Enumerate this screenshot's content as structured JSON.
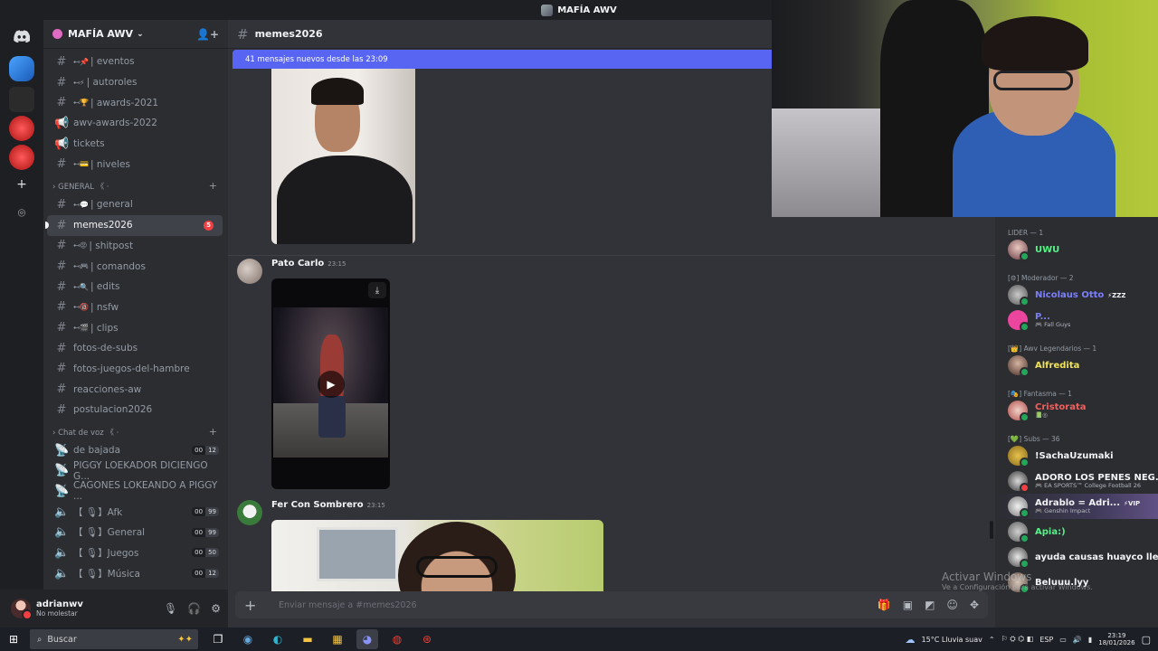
{
  "window": {
    "title": "MAFÍA AWV"
  },
  "server": {
    "name": "MAFÍA AWV"
  },
  "channels_top": [
    {
      "emoji": "⊷📌",
      "name": "| eventos",
      "type": "text"
    },
    {
      "emoji": "⊷⚡",
      "name": "| autoroles",
      "type": "text"
    },
    {
      "emoji": "⊷🏆",
      "name": "| awards-2021",
      "type": "text"
    },
    {
      "emoji": "",
      "name": "awv-awards-2022",
      "type": "announce"
    },
    {
      "emoji": "",
      "name": "tickets",
      "type": "announce"
    },
    {
      "emoji": "⊷💳",
      "name": "| niveles",
      "type": "text"
    }
  ],
  "category_general": {
    "label": "GENERAL 《 ·",
    "plus": "+"
  },
  "channels_general": [
    {
      "emoji": "⊷💬",
      "name": "| general",
      "type": "text",
      "active": false
    },
    {
      "emoji": "",
      "name": "memes2026",
      "type": "text",
      "active": true,
      "badge": "5"
    },
    {
      "emoji": "⊷😡",
      "name": "| shitpost",
      "type": "text"
    },
    {
      "emoji": "⊷🎮",
      "name": "| comandos",
      "type": "text"
    },
    {
      "emoji": "⊷🔍",
      "name": "| edits",
      "type": "text"
    },
    {
      "emoji": "⊷🔞",
      "name": "| nsfw",
      "type": "text"
    },
    {
      "emoji": "⊷🎬",
      "name": "| clips",
      "type": "text"
    },
    {
      "emoji": "",
      "name": "fotos-de-subs",
      "type": "text"
    },
    {
      "emoji": "",
      "name": "fotos-juegos-del-hambre",
      "type": "text"
    },
    {
      "emoji": "",
      "name": "reacciones-aw",
      "type": "text"
    },
    {
      "emoji": "",
      "name": "postulacion2026",
      "type": "text"
    }
  ],
  "category_voice": {
    "label": "Chat de voz 《 ·",
    "plus": "+"
  },
  "channels_voice": [
    {
      "name": "de bajada",
      "icon": "stage",
      "users": "00",
      "limit": "12"
    },
    {
      "name": "PIGGY LOEKADOR DICIENGO G...",
      "icon": "stage"
    },
    {
      "name": "CAGONES LOKEANDO A PIGGY ...",
      "icon": "stage"
    },
    {
      "name": "【 🎙】Afk",
      "icon": "voice",
      "users": "00",
      "limit": "99"
    },
    {
      "name": "【 🎙】General",
      "icon": "voice",
      "users": "00",
      "limit": "99"
    },
    {
      "name": "【 🎙】Juegos",
      "icon": "voice",
      "users": "00",
      "limit": "50"
    },
    {
      "name": "【 🎙】Música",
      "icon": "voice",
      "users": "00",
      "limit": "12"
    }
  ],
  "user": {
    "name": "adrianwv",
    "status": "No molestar"
  },
  "channel_header": {
    "name": "memes2026"
  },
  "new_messages_bar": "41 mensajes nuevos desde las 23:09",
  "messages": [
    {
      "author": "Pato Carlo",
      "time": "23:15",
      "attachment": "video"
    },
    {
      "author": "Fer Con Sombrero",
      "time": "23:15",
      "attachment": "image"
    }
  ],
  "composer": {
    "placeholder": "Enviar mensaje a #memes2026"
  },
  "members": {
    "groups": [
      {
        "label": "LIDER — 1",
        "items": [
          {
            "name": "UWU",
            "color": "#57f287",
            "status": "#23a55a"
          }
        ]
      },
      {
        "label": "[⚙] Moderador — 2",
        "items": [
          {
            "name": "Nicolaus Otto",
            "color": "#7b7ff7",
            "tag": "⚡ZZZ",
            "status": "#23a55a"
          },
          {
            "name": "P...",
            "color": "#7b7ff7",
            "sub": "🎮 Fall Guys",
            "status": "#23a55a"
          }
        ]
      },
      {
        "label": "[👑] Awv Legendarios — 1",
        "items": [
          {
            "name": "Alfredita",
            "color": "#f0e35a",
            "status": "#23a55a"
          }
        ]
      },
      {
        "label": "[🎭] Fantasma — 1",
        "items": [
          {
            "name": "Cristorata",
            "color": "#f25f5c",
            "sub": "📗◎",
            "status": "#23a55a"
          }
        ]
      },
      {
        "label": "[💚] Subs — 36",
        "items": [
          {
            "name": "!SachaUzumaki",
            "color": "#f2f3f5",
            "status": "#23a55a"
          },
          {
            "name": "ADORO LOS PENES NEG...",
            "color": "#f2f3f5",
            "sub": "🎮 EA SPORTS™ College Football 26",
            "status": "#f23f43"
          },
          {
            "name": "Adrablo = Adri...",
            "color": "#f2f3f5",
            "tag": "⚡VIP",
            "sub": "🎮 Genshin Impact",
            "status": "#23a55a",
            "highlight": true
          },
          {
            "name": "Apia:)",
            "color": "#57f287",
            "status": "#23a55a"
          },
          {
            "name": "ayuda causas huayco llev...",
            "color": "#f2f3f5",
            "status": "#23a55a"
          },
          {
            "name": "Beluuu.lyy",
            "color": "#f2f3f5",
            "status": "#23a55a"
          }
        ]
      }
    ]
  },
  "watermark": {
    "line1": "Activar Windows",
    "line2": "Ve a Configuración para activar Windows."
  },
  "taskbar": {
    "search_placeholder": "Buscar",
    "weather": "15°C  Lluvia suav",
    "lang": "ESP",
    "time": "23:19",
    "date": "18/01/2026"
  }
}
